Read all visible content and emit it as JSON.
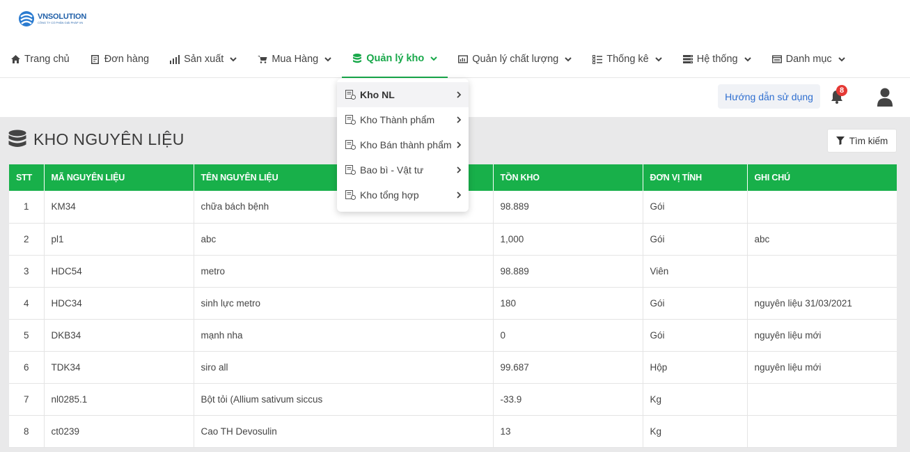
{
  "brand": {
    "name_prefix": "VN",
    "name_suffix": "SOLUTION",
    "tagline": "CÔNG TY CỔ PHẦN GIẢI PHÁP VN",
    "colors": {
      "primary": "#1f5fa8",
      "accent": "#18b04a"
    }
  },
  "nav": [
    {
      "label": "Trang chủ",
      "icon": "home-icon",
      "has_dropdown": false
    },
    {
      "label": "Đơn hàng",
      "icon": "document-icon",
      "has_dropdown": false
    },
    {
      "label": "Sản xuất",
      "icon": "chart-bars-icon",
      "has_dropdown": true
    },
    {
      "label": "Mua Hàng",
      "icon": "cart-icon",
      "has_dropdown": true
    },
    {
      "label": "Quản lý kho",
      "icon": "database-icon",
      "has_dropdown": true,
      "active": true
    },
    {
      "label": "Quản lý chất lượng",
      "icon": "chart-box-icon",
      "has_dropdown": true
    },
    {
      "label": "Thống kê",
      "icon": "list-icon",
      "has_dropdown": true
    },
    {
      "label": "Hệ thống",
      "icon": "server-icon",
      "has_dropdown": true
    },
    {
      "label": "Danh mục",
      "icon": "folder-icon",
      "has_dropdown": true
    }
  ],
  "header": {
    "help_label": "Hướng dẫn sử dụng",
    "notification_count": "8"
  },
  "dropdown": [
    {
      "label": "Kho NL",
      "selected": true
    },
    {
      "label": "Kho Thành phẩm"
    },
    {
      "label": "Kho Bán thành phẩm"
    },
    {
      "label": "Bao bì - Vật tư"
    },
    {
      "label": "Kho tổng hợp"
    }
  ],
  "page": {
    "title": "KHO NGUYÊN LIỆU",
    "search_label": "Tìm kiếm"
  },
  "table": {
    "columns": [
      "STT",
      "MÃ NGUYÊN LIỆU",
      "TÊN NGUYÊN LIỆU",
      "TỒN KHO",
      "ĐƠN VỊ TÍNH",
      "GHI CHÚ"
    ],
    "rows": [
      [
        "1",
        "KM34",
        "chữa bách bệnh",
        "98.889",
        "Gói",
        ""
      ],
      [
        "2",
        "pl1",
        "abc",
        "1,000",
        "Gói",
        "abc"
      ],
      [
        "3",
        "HDC54",
        "metro",
        "98.889",
        "Viên",
        ""
      ],
      [
        "4",
        "HDC34",
        "sinh lực metro",
        "180",
        "Gói",
        "nguyên liệu 31/03/2021"
      ],
      [
        "5",
        "DKB34",
        "mạnh nha",
        "0",
        "Gói",
        "nguyên liệu mới"
      ],
      [
        "6",
        "TDK34",
        "siro all",
        "99.687",
        "Hộp",
        "nguyên liệu mới"
      ],
      [
        "7",
        "nl0285.1",
        "Bột tỏi (Allium sativum siccus",
        "-33.9",
        "Kg",
        ""
      ],
      [
        "8",
        "ct0239",
        "Cao TH Devosulin",
        "13",
        "Kg",
        ""
      ]
    ]
  }
}
